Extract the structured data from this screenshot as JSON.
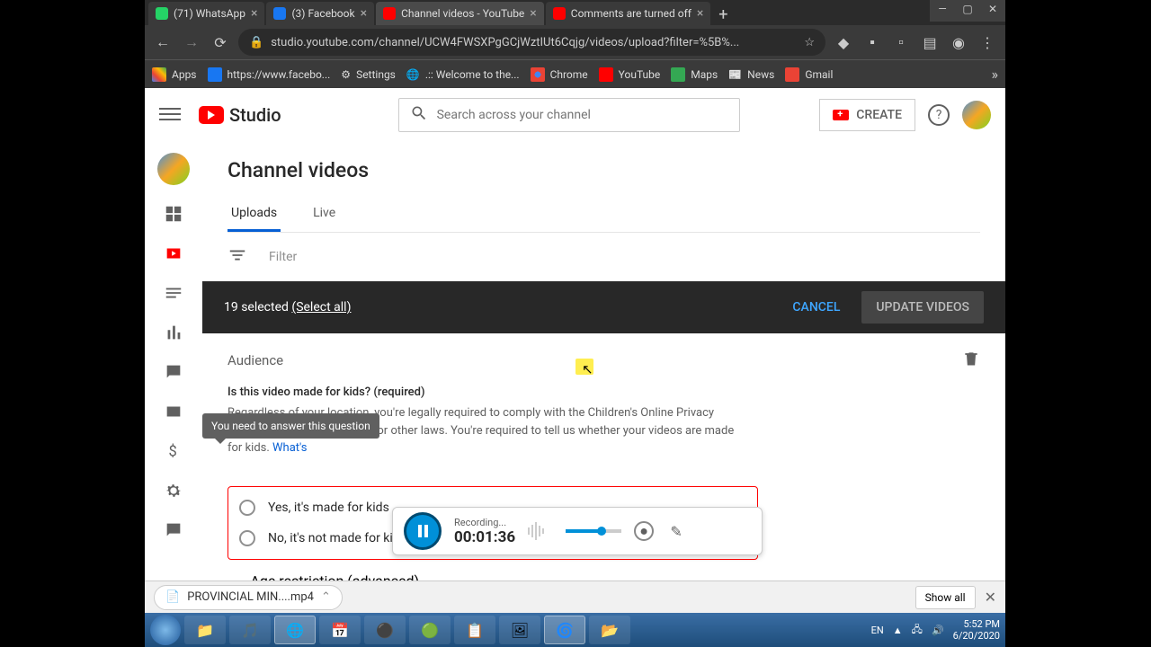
{
  "browser": {
    "tabs": [
      {
        "title": "(71) WhatsApp",
        "icon_bg": "#25d366"
      },
      {
        "title": "(3) Facebook",
        "icon_bg": "#1877f2"
      },
      {
        "title": "Channel videos - YouTube",
        "icon_bg": "#ff0000",
        "active": true
      },
      {
        "title": "Comments are turned off",
        "icon_bg": "#ff0000"
      }
    ],
    "url": "studio.youtube.com/channel/UCW4FWSXPgGCjWztIUt6Cqjg/videos/upload?filter=%5B%...",
    "bookmarks": [
      {
        "label": "Apps"
      },
      {
        "label": "https://www.facebo..."
      },
      {
        "label": "Settings"
      },
      {
        "label": ".:: Welcome to the..."
      },
      {
        "label": "Chrome"
      },
      {
        "label": "YouTube"
      },
      {
        "label": "Maps"
      },
      {
        "label": "News"
      },
      {
        "label": "Gmail"
      }
    ]
  },
  "studio": {
    "logo_text": "Studio",
    "search_placeholder": "Search across your channel",
    "create_label": "CREATE",
    "page_title": "Channel videos",
    "tabs": {
      "uploads": "Uploads",
      "live": "Live"
    },
    "filter_placeholder": "Filter",
    "selection": {
      "count_text": "19 selected",
      "select_all": "(Select all)",
      "cancel": "CANCEL",
      "update": "UPDATE VIDEOS"
    },
    "audience_title": "Audience",
    "question": "Is this video made for kids? (required)",
    "desc_text": "Regardless of your location, you're legally required to comply with the Children's Online Privacy Protection Act (COPPA) and/or other laws. You're required to tell us whether your videos are made for kids. ",
    "whats_link": "What's",
    "tooltip_text": "You need to answer this question",
    "radio_yes": "Yes, it's made for kids",
    "radio_no": "No, it's not made for kids",
    "age_restriction": "Age restriction (advanced)"
  },
  "recorder": {
    "status": "Recording...",
    "time": "00:01:36"
  },
  "download": {
    "filename": "PROVINCIAL MIN....mp4",
    "show_all": "Show all"
  },
  "tray": {
    "lang": "EN",
    "time": "5:52 PM",
    "date": "6/20/2020"
  }
}
